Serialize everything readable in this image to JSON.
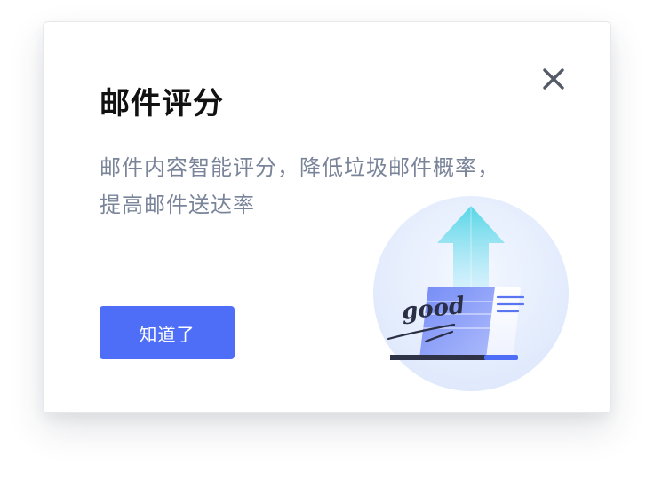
{
  "dialog": {
    "title": "邮件评分",
    "description_lines": [
      "邮件内容智能评分，降低垃圾邮件概率，",
      "提高邮件送达率"
    ],
    "confirm_label": "知道了",
    "illustration_text": "good"
  },
  "colors": {
    "accent": "#4f6ef7",
    "title": "#111111",
    "description": "#7a8499",
    "close_icon": "#555b66",
    "arrow": "#5fdbe8"
  },
  "icons": {
    "close": "close-icon"
  }
}
